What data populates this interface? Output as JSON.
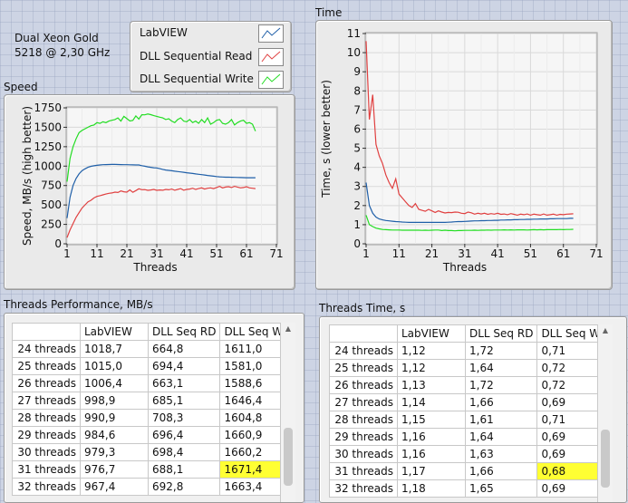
{
  "cpu_label": [
    "Dual Xeon Gold",
    "5218 @ 2,30 GHz"
  ],
  "legend": [
    {
      "name": "LabVIEW",
      "color": "#1f5fa8"
    },
    {
      "name": "DLL Sequential Read",
      "color": "#e04040"
    },
    {
      "name": "DLL Sequential Write",
      "color": "#22dd22"
    }
  ],
  "speed_panel": {
    "caption": "Speed"
  },
  "time_panel": {
    "caption": "Time"
  },
  "chart_data": [
    {
      "type": "line",
      "title": "Speed",
      "xlabel": "Threads",
      "ylabel": "Speed, MB/s (high better)",
      "xlim": [
        1,
        71
      ],
      "ylim": [
        0,
        1750
      ],
      "xticks": [
        1,
        11,
        21,
        31,
        41,
        51,
        61,
        71
      ],
      "yticks": [
        0,
        250,
        500,
        750,
        1000,
        1250,
        1500,
        1750
      ],
      "grid": true,
      "x": [
        1,
        2,
        3,
        4,
        5,
        6,
        7,
        8,
        9,
        10,
        11,
        12,
        13,
        14,
        15,
        16,
        17,
        18,
        19,
        20,
        21,
        22,
        23,
        24,
        25,
        26,
        27,
        28,
        29,
        30,
        31,
        32,
        33,
        34,
        35,
        36,
        37,
        38,
        39,
        40,
        41,
        42,
        43,
        44,
        45,
        46,
        47,
        48,
        49,
        50,
        51,
        52,
        53,
        54,
        55,
        56,
        57,
        58,
        59,
        60,
        61,
        62,
        63,
        64
      ],
      "series": [
        {
          "name": "LabVIEW",
          "color": "#1f5fa8",
          "values": [
            330,
            600,
            750,
            840,
            900,
            940,
            965,
            985,
            998,
            1005,
            1010,
            1015,
            1018,
            1020,
            1021,
            1022,
            1022,
            1021,
            1020,
            1019,
            1018,
            1017,
            1016,
            1015,
            1015,
            1006,
            999,
            991,
            985,
            979,
            977,
            967,
            958,
            950,
            945,
            940,
            935,
            930,
            925,
            920,
            915,
            910,
            905,
            900,
            895,
            890,
            885,
            880,
            875,
            870,
            866,
            862,
            860,
            858,
            857,
            856,
            855,
            854,
            853,
            852,
            851,
            850,
            850,
            850
          ]
        },
        {
          "name": "DLL Sequential Read",
          "color": "#e04040",
          "values": [
            80,
            180,
            260,
            340,
            400,
            460,
            500,
            540,
            560,
            590,
            610,
            620,
            630,
            640,
            650,
            655,
            665,
            660,
            680,
            670,
            665,
            694,
            663,
            685,
            708,
            696,
            698,
            688,
            693,
            700,
            688,
            693,
            690,
            700,
            695,
            705,
            690,
            700,
            710,
            690,
            700,
            705,
            715,
            700,
            710,
            720,
            705,
            715,
            720,
            710,
            725,
            740,
            720,
            730,
            735,
            725,
            740,
            730,
            720,
            725,
            735,
            720,
            715,
            710
          ]
        },
        {
          "name": "DLL Sequential Write",
          "color": "#22dd22",
          "values": [
            800,
            1100,
            1250,
            1350,
            1430,
            1460,
            1480,
            1500,
            1520,
            1530,
            1560,
            1550,
            1570,
            1560,
            1580,
            1590,
            1600,
            1620,
            1580,
            1640,
            1611,
            1581,
            1589,
            1646,
            1605,
            1661,
            1660,
            1671,
            1663,
            1650,
            1640,
            1630,
            1620,
            1600,
            1610,
            1580,
            1560,
            1600,
            1620,
            1580,
            1570,
            1600,
            1560,
            1580,
            1550,
            1600,
            1560,
            1620,
            1540,
            1560,
            1590,
            1600,
            1550,
            1540,
            1560,
            1600,
            1530,
            1560,
            1580,
            1590,
            1550,
            1560,
            1540,
            1450
          ]
        }
      ]
    },
    {
      "type": "line",
      "title": "Time",
      "xlabel": "Threads",
      "ylabel": "Time, s (lower better)",
      "xlim": [
        1,
        71
      ],
      "ylim": [
        0,
        11
      ],
      "xticks": [
        1,
        11,
        21,
        31,
        41,
        51,
        61,
        71
      ],
      "yticks": [
        0,
        1,
        2,
        3,
        4,
        5,
        6,
        7,
        8,
        9,
        10,
        11
      ],
      "grid": true,
      "x": [
        1,
        2,
        3,
        4,
        5,
        6,
        7,
        8,
        9,
        10,
        11,
        12,
        13,
        14,
        15,
        16,
        17,
        18,
        19,
        20,
        21,
        22,
        23,
        24,
        25,
        26,
        27,
        28,
        29,
        30,
        31,
        32,
        33,
        34,
        35,
        36,
        37,
        38,
        39,
        40,
        41,
        42,
        43,
        44,
        45,
        46,
        47,
        48,
        49,
        50,
        51,
        52,
        53,
        54,
        55,
        56,
        57,
        58,
        59,
        60,
        61,
        62,
        63,
        64
      ],
      "series": [
        {
          "name": "LabVIEW",
          "color": "#1f5fa8",
          "values": [
            3.2,
            2.0,
            1.6,
            1.4,
            1.3,
            1.25,
            1.22,
            1.2,
            1.18,
            1.16,
            1.15,
            1.14,
            1.13,
            1.12,
            1.12,
            1.12,
            1.12,
            1.12,
            1.12,
            1.12,
            1.12,
            1.12,
            1.12,
            1.12,
            1.12,
            1.13,
            1.14,
            1.15,
            1.16,
            1.16,
            1.17,
            1.18,
            1.19,
            1.2,
            1.2,
            1.21,
            1.21,
            1.22,
            1.22,
            1.23,
            1.23,
            1.24,
            1.24,
            1.25,
            1.25,
            1.26,
            1.26,
            1.27,
            1.27,
            1.28,
            1.28,
            1.29,
            1.29,
            1.3,
            1.3,
            1.3,
            1.31,
            1.31,
            1.32,
            1.32,
            1.32,
            1.32,
            1.33,
            1.33
          ]
        },
        {
          "name": "DLL Sequential Read",
          "color": "#e04040",
          "values": [
            10.6,
            6.5,
            7.8,
            5.2,
            4.6,
            4.2,
            3.6,
            3.2,
            2.9,
            3.4,
            2.6,
            2.4,
            2.2,
            2.0,
            1.9,
            2.1,
            1.8,
            1.75,
            1.7,
            1.8,
            1.72,
            1.64,
            1.72,
            1.66,
            1.61,
            1.64,
            1.63,
            1.66,
            1.65,
            1.6,
            1.58,
            1.66,
            1.62,
            1.55,
            1.6,
            1.56,
            1.6,
            1.54,
            1.58,
            1.55,
            1.6,
            1.54,
            1.56,
            1.52,
            1.58,
            1.54,
            1.5,
            1.55,
            1.52,
            1.56,
            1.5,
            1.55,
            1.52,
            1.5,
            1.56,
            1.5,
            1.52,
            1.55,
            1.5,
            1.54,
            1.52,
            1.55,
            1.56,
            1.57
          ]
        },
        {
          "name": "DLL Sequential Write",
          "color": "#22dd22",
          "values": [
            1.5,
            1.0,
            0.9,
            0.82,
            0.78,
            0.75,
            0.74,
            0.73,
            0.72,
            0.72,
            0.72,
            0.71,
            0.71,
            0.71,
            0.71,
            0.71,
            0.71,
            0.7,
            0.71,
            0.7,
            0.71,
            0.72,
            0.72,
            0.69,
            0.71,
            0.69,
            0.69,
            0.68,
            0.69,
            0.69,
            0.7,
            0.7,
            0.7,
            0.71,
            0.7,
            0.71,
            0.71,
            0.72,
            0.71,
            0.72,
            0.72,
            0.72,
            0.73,
            0.72,
            0.73,
            0.72,
            0.73,
            0.73,
            0.73,
            0.72,
            0.73,
            0.74,
            0.73,
            0.74,
            0.73,
            0.74,
            0.74,
            0.74,
            0.74,
            0.75,
            0.74,
            0.75,
            0.75,
            0.76
          ]
        }
      ]
    }
  ],
  "perf_table": {
    "caption": "Threads Performance, MB/s",
    "headers": [
      "",
      "LabVIEW",
      "DLL Seq RD",
      "DLL Seq WR"
    ],
    "rows": [
      [
        "24 threads",
        "1018,7",
        "664,8",
        "1611,0"
      ],
      [
        "25 threads",
        "1015,0",
        "694,4",
        "1581,0"
      ],
      [
        "26 threads",
        "1006,4",
        "663,1",
        "1588,6"
      ],
      [
        "27 threads",
        "998,9",
        "685,1",
        "1646,4"
      ],
      [
        "28 threads",
        "990,9",
        "708,3",
        "1604,8"
      ],
      [
        "29 threads",
        "984,6",
        "696,4",
        "1660,9"
      ],
      [
        "30 threads",
        "979,3",
        "698,4",
        "1660,2"
      ],
      [
        "31 threads",
        "976,7",
        "688,1",
        "1671,4"
      ],
      [
        "32 threads",
        "967,4",
        "692,8",
        "1663,4"
      ]
    ],
    "highlight": {
      "row": 7,
      "col": 3
    }
  },
  "time_table": {
    "caption": "Threads Time, s",
    "headers": [
      "",
      "LabVIEW",
      "DLL Seq RD",
      "DLL Seq WR"
    ],
    "rows": [
      [
        "24 threads",
        "1,12",
        "1,72",
        "0,71"
      ],
      [
        "25 threads",
        "1,12",
        "1,64",
        "0,72"
      ],
      [
        "26 threads",
        "1,13",
        "1,72",
        "0,72"
      ],
      [
        "27 threads",
        "1,14",
        "1,66",
        "0,69"
      ],
      [
        "28 threads",
        "1,15",
        "1,61",
        "0,71"
      ],
      [
        "29 threads",
        "1,16",
        "1,64",
        "0,69"
      ],
      [
        "30 threads",
        "1,16",
        "1,63",
        "0,69"
      ],
      [
        "31 threads",
        "1,17",
        "1,66",
        "0,68"
      ],
      [
        "32 threads",
        "1,18",
        "1,65",
        "0,69"
      ]
    ],
    "highlight": {
      "row": 7,
      "col": 3
    }
  }
}
